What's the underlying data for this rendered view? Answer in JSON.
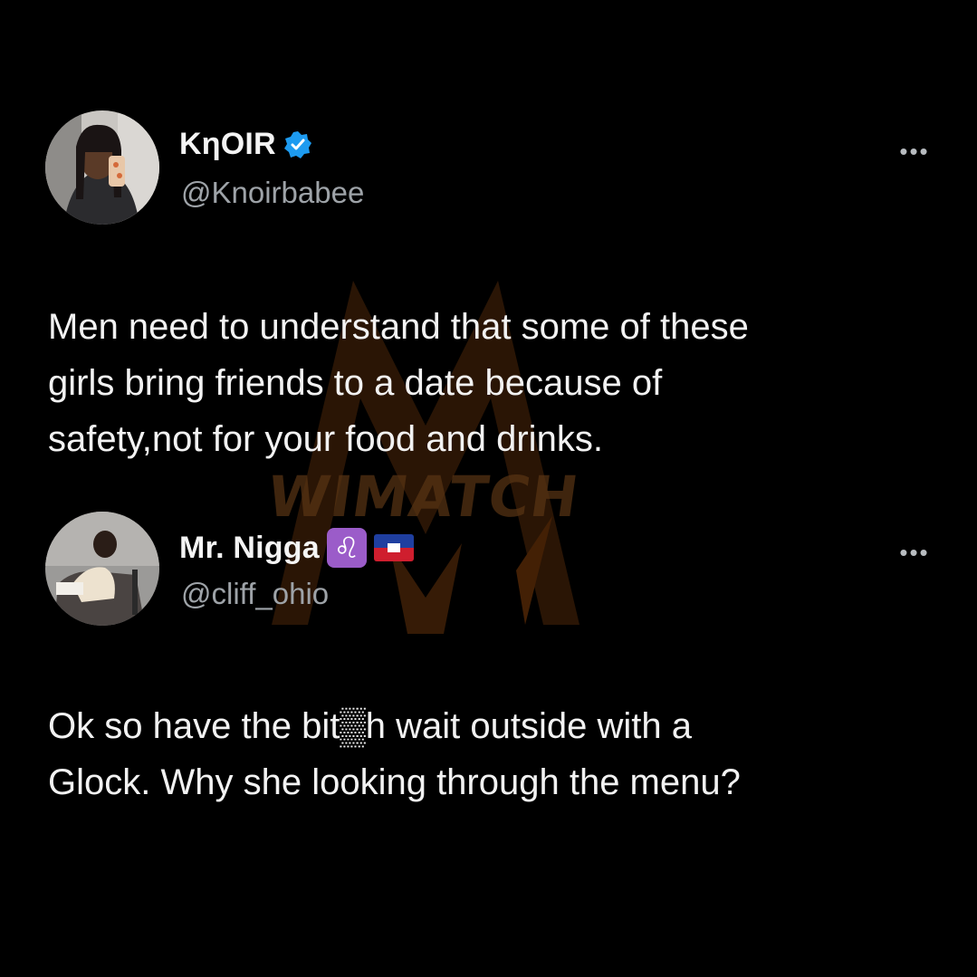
{
  "watermark": {
    "text": "WIMATCH"
  },
  "tweets": [
    {
      "author": {
        "display_name": "KηOIR",
        "handle": "@Knoirbabee",
        "verified": true
      },
      "avatar_icon": "profile-photo",
      "more_icon": "more-horizontal-icon",
      "more_label": "•••",
      "text": "Men need to understand that some of these\ngirls bring friends to a date because of\nsafety,not for your food and drinks."
    },
    {
      "author": {
        "display_name": "Mr. Nigga",
        "handle": "@cliff_ohio",
        "badge_emoji": "♌",
        "flag": "haiti-flag"
      },
      "avatar_icon": "profile-photo",
      "more_icon": "more-horizontal-icon",
      "more_label": "•••",
      "text": "Ok so have the bit▒h wait outside with a\nGlock. Why she looking through the menu?"
    }
  ],
  "colors": {
    "background": "#000000",
    "verified": "#1d9bf0",
    "leo_badge": "#9b5cc9",
    "watermark": "#8a4a14"
  }
}
